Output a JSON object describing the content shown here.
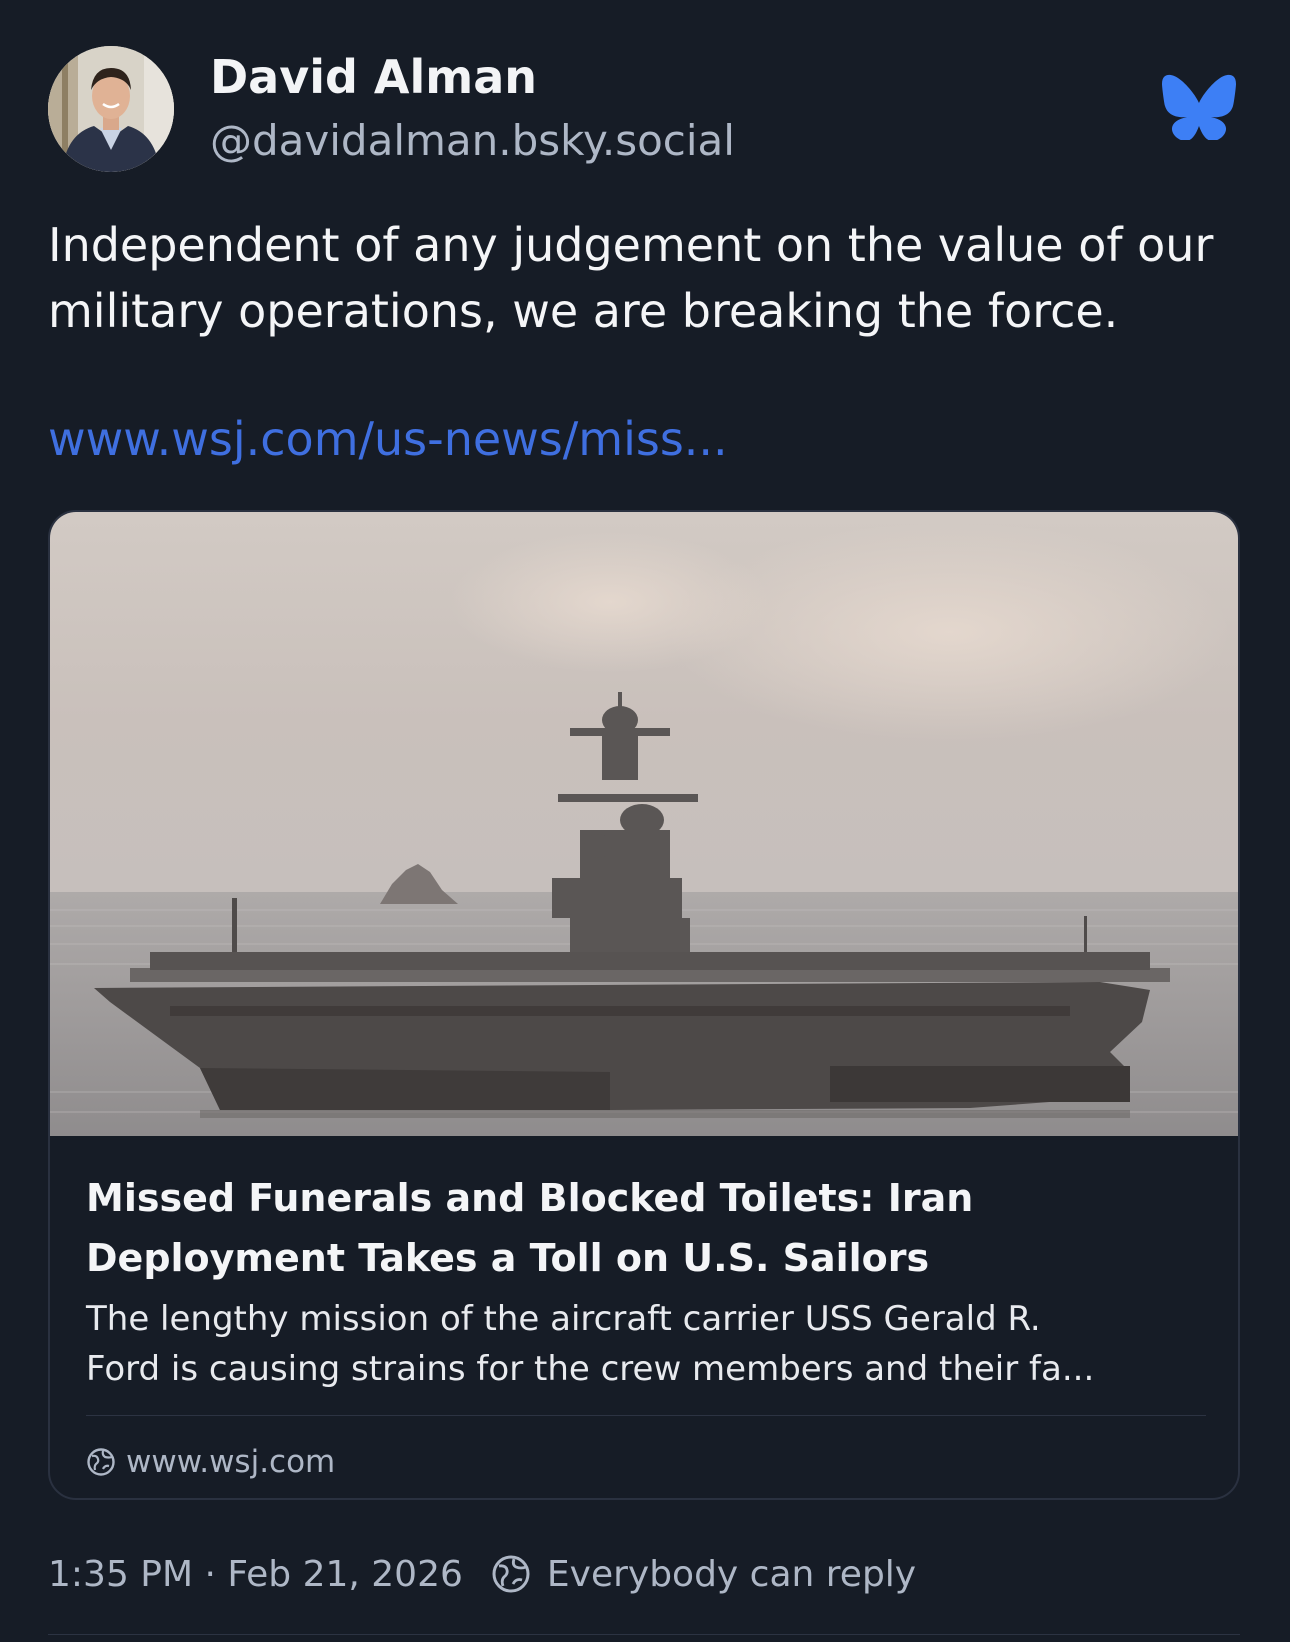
{
  "author": {
    "display_name": "David Alman",
    "handle": "@davidalman.bsky.social",
    "avatar_icon": "profile-photo"
  },
  "post": {
    "text_lines": [
      "Independent of any judgement on the value of our",
      "military operations, we are breaking the force."
    ],
    "link_text": "www.wsj.com/us-news/miss..."
  },
  "embed": {
    "image_subject": "aircraft carrier at sea",
    "title_lines": [
      "Missed Funerals and Blocked Toilets: Iran",
      "Deployment Takes a Toll on U.S. Sailors"
    ],
    "description_lines": [
      "The lengthy mission of the aircraft carrier USS Gerald R.",
      "Ford is causing strains for the crew members and their fa..."
    ],
    "domain": "www.wsj.com",
    "domain_icon": "globe-icon"
  },
  "meta": {
    "timestamp": "1:35 PM · Feb 21, 2026",
    "reply_setting": "Everybody can reply",
    "reply_icon": "globe-icon"
  },
  "colors": {
    "background": "#161c26",
    "link": "#3f6fe0",
    "brand_butterfly": "#3d7ff5",
    "muted_text": "#aeb7c6"
  }
}
